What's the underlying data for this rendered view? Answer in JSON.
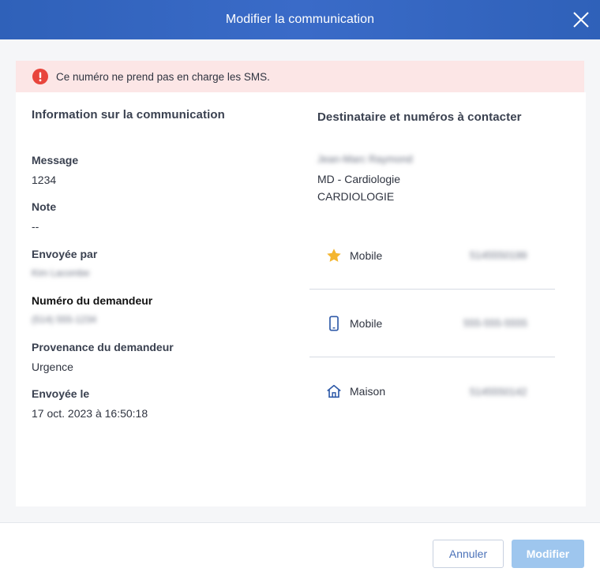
{
  "dialog": {
    "title": "Modifier la communication"
  },
  "alert": {
    "message": "Ce numéro ne prend pas en charge les SMS."
  },
  "info": {
    "title": "Information sur la communication",
    "fields": [
      {
        "label": "Message",
        "value": "1234"
      },
      {
        "label": "Note",
        "value": "--"
      },
      {
        "label": "Envoyée par",
        "value": "Kim Lacombe"
      },
      {
        "label": "Numéro du demandeur",
        "value": "(514) 555-1234"
      },
      {
        "label": "Provenance du demandeur",
        "value": "Urgence"
      },
      {
        "label": "Envoyée le",
        "value": "17 oct. 2023 à 16:50:18"
      }
    ]
  },
  "recipient": {
    "title": "Destinataire et numéros à contacter",
    "name": "Jean-Marc Raymond",
    "role": "MD - Cardiologie",
    "department": "CARDIOLOGIE",
    "phones": [
      {
        "type": "Mobile",
        "number": "5145550199",
        "icon": "star-icon"
      },
      {
        "type": "Mobile",
        "number": "555-555-5555",
        "icon": "mobile-phone-icon"
      },
      {
        "type": "Maison",
        "number": "5145550142",
        "icon": "home-icon"
      }
    ]
  },
  "footer": {
    "cancel_label": "Annuler",
    "save_label": "Modifier"
  },
  "colors": {
    "header": "#2f61b9",
    "alert_bg": "#fce6e6",
    "alert_icon": "#e8453c",
    "star": "#f4b630",
    "icon_blue": "#2f5aa8",
    "primary_disabled": "#9ec6ee"
  }
}
